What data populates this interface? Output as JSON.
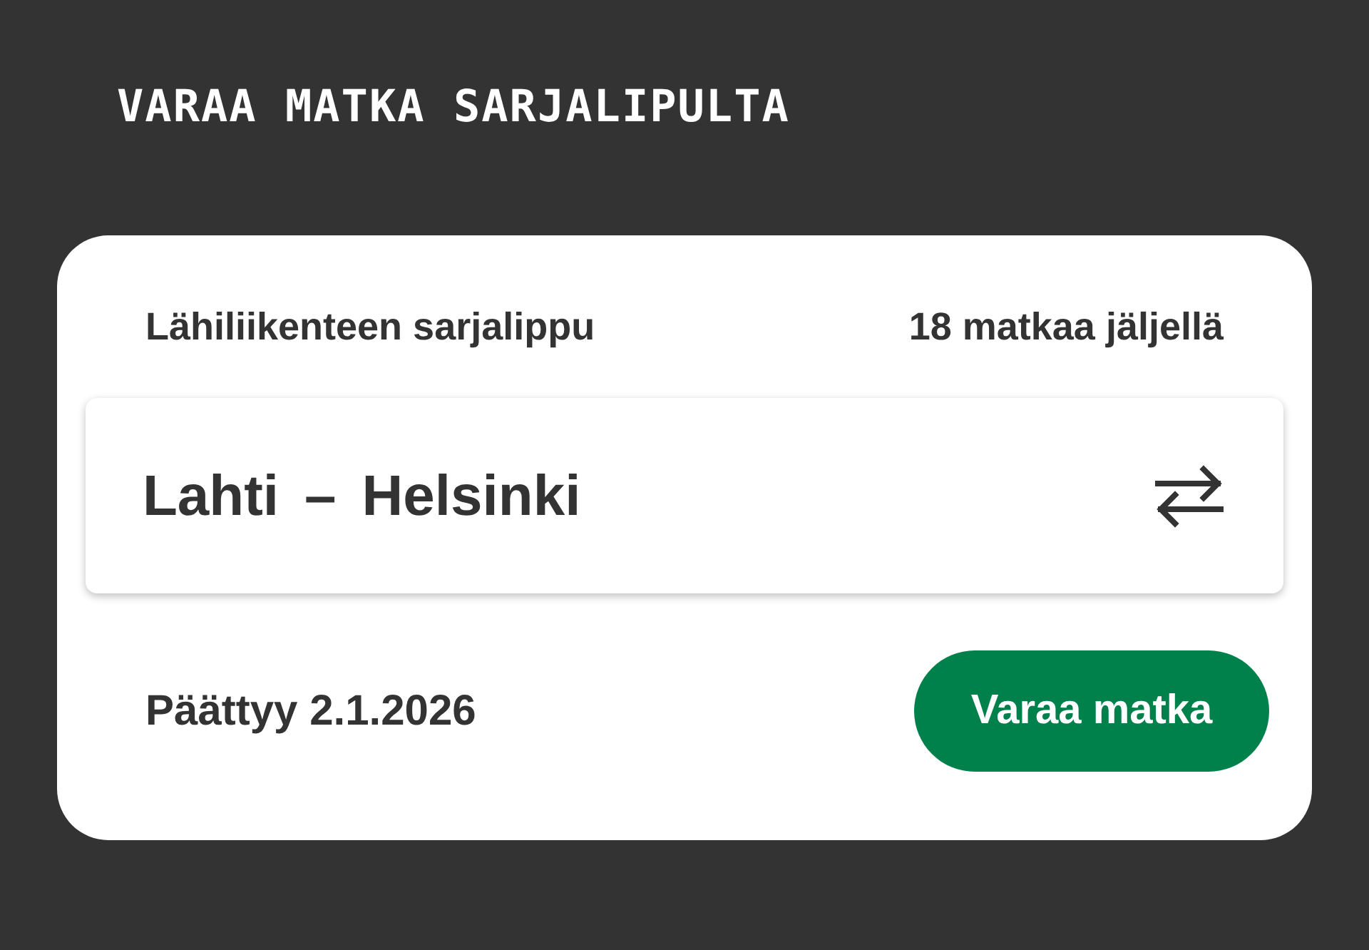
{
  "heading": "VARAA MATKA SARJALIPULTA",
  "ticket": {
    "name": "Lähiliikenteen sarjalippu",
    "remaining": "18 matkaa jäljellä",
    "route": {
      "from": "Lahti",
      "separator": "–",
      "to": "Helsinki"
    },
    "expiry": "Päättyy 2.1.2026",
    "button": "Varaa matka"
  }
}
